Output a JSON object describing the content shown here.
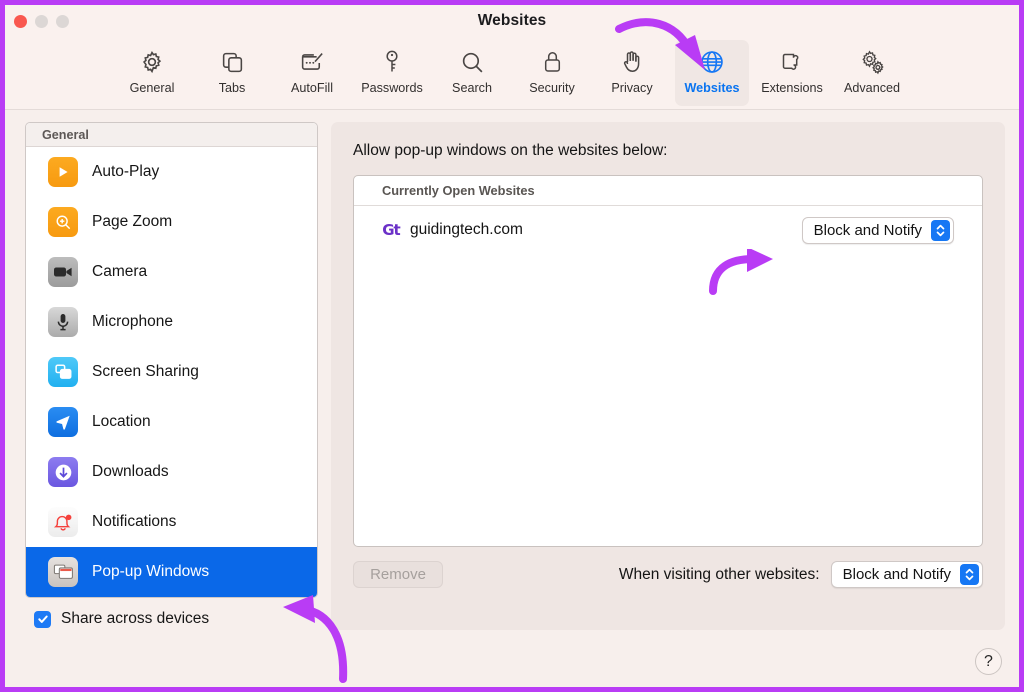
{
  "window": {
    "title": "Websites",
    "traffic_lights": [
      "close-red",
      "minimize-gray",
      "zoom-gray"
    ],
    "accent_highlight": "#b93cf5",
    "selected_accent": "#0a74f0"
  },
  "toolbar": {
    "items": [
      {
        "label": "General",
        "icon": "gear-icon",
        "selected": false
      },
      {
        "label": "Tabs",
        "icon": "tabs-icon",
        "selected": false
      },
      {
        "label": "AutoFill",
        "icon": "autofill-icon",
        "selected": false
      },
      {
        "label": "Passwords",
        "icon": "key-icon",
        "selected": false
      },
      {
        "label": "Search",
        "icon": "search-icon",
        "selected": false
      },
      {
        "label": "Security",
        "icon": "lock-icon",
        "selected": false
      },
      {
        "label": "Privacy",
        "icon": "hand-icon",
        "selected": false
      },
      {
        "label": "Websites",
        "icon": "globe-icon",
        "selected": true
      },
      {
        "label": "Extensions",
        "icon": "puzzle-icon",
        "selected": false
      },
      {
        "label": "Advanced",
        "icon": "gears-icon",
        "selected": false
      }
    ]
  },
  "sidebar": {
    "header": "General",
    "items": [
      {
        "label": "Auto-Play",
        "icon": "play-icon",
        "selected": false
      },
      {
        "label": "Page Zoom",
        "icon": "zoom-in-icon",
        "selected": false
      },
      {
        "label": "Camera",
        "icon": "camera-icon",
        "selected": false
      },
      {
        "label": "Microphone",
        "icon": "microphone-icon",
        "selected": false
      },
      {
        "label": "Screen Sharing",
        "icon": "screen-share-icon",
        "selected": false
      },
      {
        "label": "Location",
        "icon": "location-arrow-icon",
        "selected": false
      },
      {
        "label": "Downloads",
        "icon": "download-icon",
        "selected": false
      },
      {
        "label": "Notifications",
        "icon": "bell-icon",
        "selected": false
      },
      {
        "label": "Pop-up Windows",
        "icon": "popup-windows-icon",
        "selected": true
      }
    ],
    "share_across_devices": {
      "label": "Share across devices",
      "checked": true
    }
  },
  "main": {
    "title": "Allow pop-up windows on the websites below:",
    "list_header": "Currently Open Websites",
    "rows": [
      {
        "favicon": "Gt",
        "site": "guidingtech.com",
        "setting": "Block and Notify"
      }
    ],
    "remove_button": "Remove",
    "footer_label": "When visiting other websites:",
    "footer_setting": "Block and Notify",
    "help_button": "?"
  },
  "annotations": [
    {
      "name": "arrow-to-websites-tab",
      "color": "#b93cf5"
    },
    {
      "name": "arrow-to-site-dropdown",
      "color": "#b93cf5"
    },
    {
      "name": "arrow-to-popup-windows",
      "color": "#b93cf5"
    }
  ]
}
